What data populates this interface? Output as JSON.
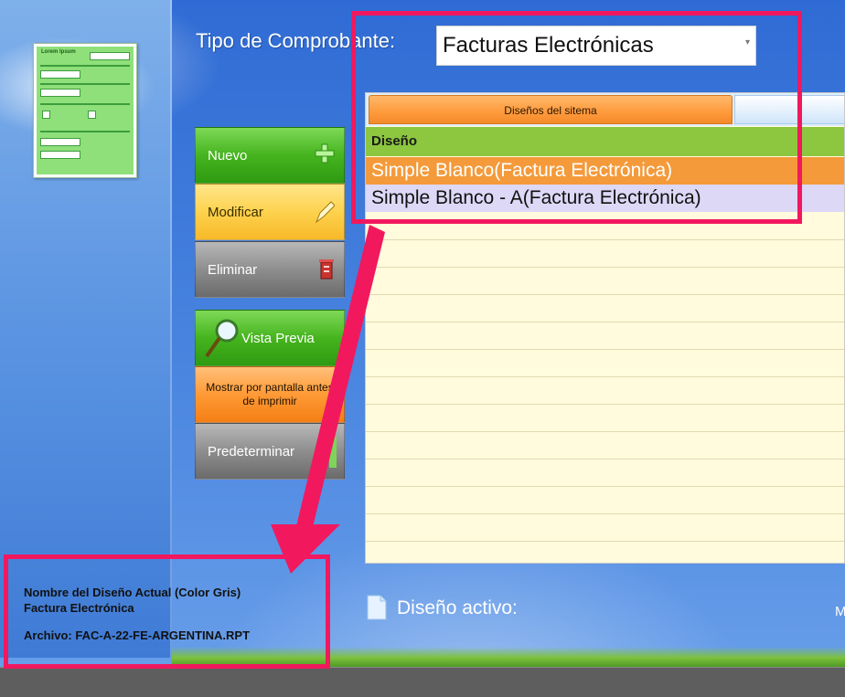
{
  "header": {
    "tipo_label": "Tipo de Comprobante:",
    "tipo_value": "Facturas Electrónicas"
  },
  "buttons": {
    "nuevo": "Nuevo",
    "modificar": "Modificar",
    "eliminar": "Eliminar",
    "vista_previa": "Vista Previa",
    "mostrar_line1": "Mostrar por pantalla antes",
    "mostrar_line2": "de imprimir",
    "predeterminar": "Predeterminar"
  },
  "grid": {
    "tab_active": "Diseños del sitema",
    "column_header": "Diseño",
    "rows": [
      "Simple Blanco(Factura Electrónica)",
      "Simple Blanco - A(Factura Electrónica)"
    ],
    "selected_index": 0
  },
  "status": {
    "disenio_activo": "Diseño activo:",
    "trailing": "M"
  },
  "info": {
    "line1": "Nombre del Diseño Actual (Color Gris)",
    "line2": "Factura Electrónica",
    "archivo": "Archivo: FAC-A-22-FE-ARGENTINA.RPT"
  },
  "thumbnail": {
    "title": "Lorem Ipsum"
  },
  "colors": {
    "highlight": "#f2185e",
    "selected_row": "#f49a3a",
    "header_row": "#8dc63f"
  },
  "icons": [
    "plus-icon",
    "pencil-icon",
    "trash-icon",
    "magnifier-icon",
    "document-icon"
  ]
}
